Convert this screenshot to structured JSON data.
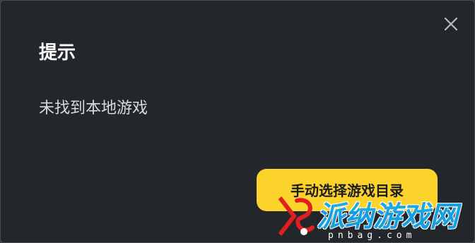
{
  "dialog": {
    "title": "提示",
    "message": "未找到本地游戏",
    "primary_button_label": "手动选择游戏目录",
    "close_icon": "close-icon"
  },
  "watermark": {
    "text": "派纳游戏网",
    "domain": "pnbag.com"
  },
  "colors": {
    "dialog_bg": "#23262b",
    "accent": "#fcd32a",
    "watermark_blue": "#14a7ea",
    "watermark_red": "#e02020"
  }
}
